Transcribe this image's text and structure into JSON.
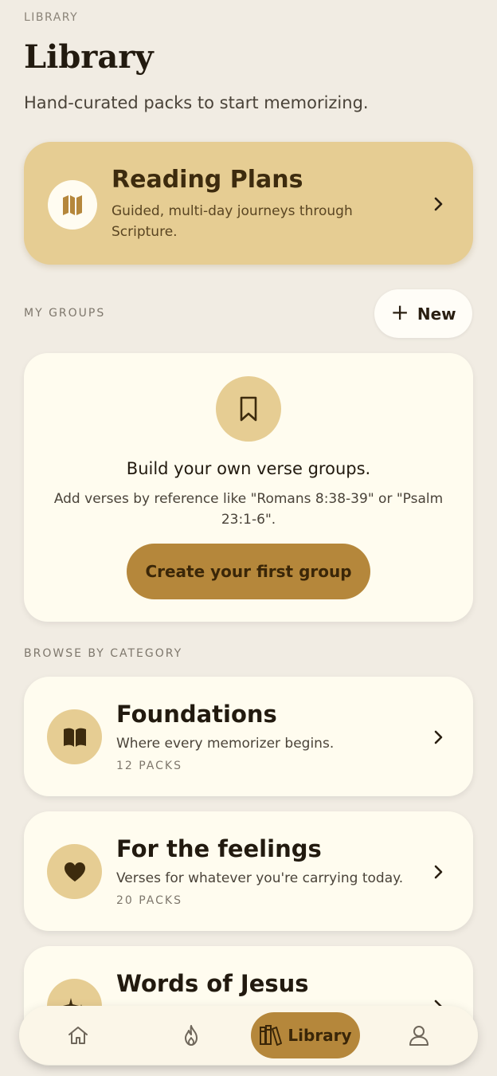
{
  "header": {
    "eyebrow": "LIBRARY",
    "title": "Library",
    "subtitle": "Hand-curated packs to start memorizing."
  },
  "reading_plans": {
    "title": "Reading Plans",
    "description": "Guided, multi-day journeys through Scripture.",
    "icon": "map-icon"
  },
  "groups": {
    "section_label": "MY GROUPS",
    "new_button_label": "New",
    "empty_title": "Build your own verse groups.",
    "empty_description": "Add verses by reference like \"Romans 8:38-39\" or \"Psalm 23:1-6\".",
    "create_button_label": "Create your first group",
    "icon": "bookmark-icon"
  },
  "categories": {
    "section_label": "BROWSE BY CATEGORY",
    "items": [
      {
        "title": "Foundations",
        "description": "Where every memorizer begins.",
        "count": "12 PACKS",
        "icon": "open-book-icon"
      },
      {
        "title": "For the feelings",
        "description": "Verses for whatever you're carrying today.",
        "count": "20 PACKS",
        "icon": "heart-icon"
      },
      {
        "title": "Words of Jesus",
        "description": "",
        "count": "",
        "icon": "sparkles-icon"
      }
    ]
  },
  "tab_bar": {
    "items": [
      {
        "name": "home",
        "icon": "home-icon",
        "label": ""
      },
      {
        "name": "streak",
        "icon": "flame-icon",
        "label": ""
      },
      {
        "name": "library",
        "icon": "library-icon",
        "label": "Library",
        "active": true
      },
      {
        "name": "profile",
        "icon": "person-icon",
        "label": ""
      }
    ]
  },
  "colors": {
    "background": "#F1ECE3",
    "accent_gold": "#B5873B",
    "soft_gold": "#E6CD93",
    "card": "#FFFCEF"
  }
}
